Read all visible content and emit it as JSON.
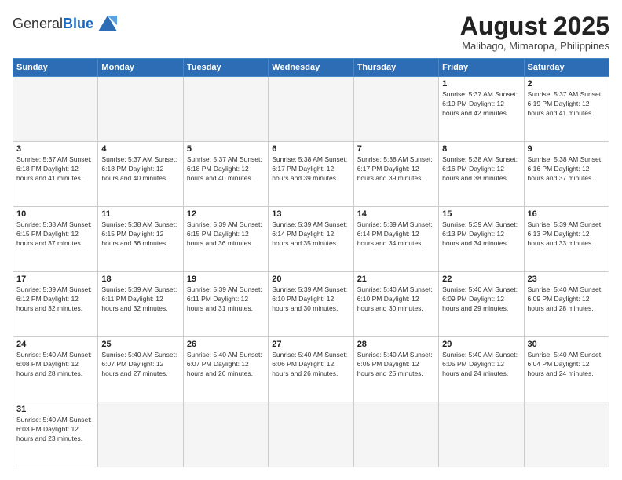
{
  "header": {
    "logo_general": "General",
    "logo_blue": "Blue",
    "month_title": "August 2025",
    "location": "Malibago, Mimaropa, Philippines"
  },
  "weekdays": [
    "Sunday",
    "Monday",
    "Tuesday",
    "Wednesday",
    "Thursday",
    "Friday",
    "Saturday"
  ],
  "weeks": [
    [
      {
        "day": "",
        "info": ""
      },
      {
        "day": "",
        "info": ""
      },
      {
        "day": "",
        "info": ""
      },
      {
        "day": "",
        "info": ""
      },
      {
        "day": "",
        "info": ""
      },
      {
        "day": "1",
        "info": "Sunrise: 5:37 AM\nSunset: 6:19 PM\nDaylight: 12 hours\nand 42 minutes."
      },
      {
        "day": "2",
        "info": "Sunrise: 5:37 AM\nSunset: 6:19 PM\nDaylight: 12 hours\nand 41 minutes."
      }
    ],
    [
      {
        "day": "3",
        "info": "Sunrise: 5:37 AM\nSunset: 6:18 PM\nDaylight: 12 hours\nand 41 minutes."
      },
      {
        "day": "4",
        "info": "Sunrise: 5:37 AM\nSunset: 6:18 PM\nDaylight: 12 hours\nand 40 minutes."
      },
      {
        "day": "5",
        "info": "Sunrise: 5:37 AM\nSunset: 6:18 PM\nDaylight: 12 hours\nand 40 minutes."
      },
      {
        "day": "6",
        "info": "Sunrise: 5:38 AM\nSunset: 6:17 PM\nDaylight: 12 hours\nand 39 minutes."
      },
      {
        "day": "7",
        "info": "Sunrise: 5:38 AM\nSunset: 6:17 PM\nDaylight: 12 hours\nand 39 minutes."
      },
      {
        "day": "8",
        "info": "Sunrise: 5:38 AM\nSunset: 6:16 PM\nDaylight: 12 hours\nand 38 minutes."
      },
      {
        "day": "9",
        "info": "Sunrise: 5:38 AM\nSunset: 6:16 PM\nDaylight: 12 hours\nand 37 minutes."
      }
    ],
    [
      {
        "day": "10",
        "info": "Sunrise: 5:38 AM\nSunset: 6:15 PM\nDaylight: 12 hours\nand 37 minutes."
      },
      {
        "day": "11",
        "info": "Sunrise: 5:38 AM\nSunset: 6:15 PM\nDaylight: 12 hours\nand 36 minutes."
      },
      {
        "day": "12",
        "info": "Sunrise: 5:39 AM\nSunset: 6:15 PM\nDaylight: 12 hours\nand 36 minutes."
      },
      {
        "day": "13",
        "info": "Sunrise: 5:39 AM\nSunset: 6:14 PM\nDaylight: 12 hours\nand 35 minutes."
      },
      {
        "day": "14",
        "info": "Sunrise: 5:39 AM\nSunset: 6:14 PM\nDaylight: 12 hours\nand 34 minutes."
      },
      {
        "day": "15",
        "info": "Sunrise: 5:39 AM\nSunset: 6:13 PM\nDaylight: 12 hours\nand 34 minutes."
      },
      {
        "day": "16",
        "info": "Sunrise: 5:39 AM\nSunset: 6:13 PM\nDaylight: 12 hours\nand 33 minutes."
      }
    ],
    [
      {
        "day": "17",
        "info": "Sunrise: 5:39 AM\nSunset: 6:12 PM\nDaylight: 12 hours\nand 32 minutes."
      },
      {
        "day": "18",
        "info": "Sunrise: 5:39 AM\nSunset: 6:11 PM\nDaylight: 12 hours\nand 32 minutes."
      },
      {
        "day": "19",
        "info": "Sunrise: 5:39 AM\nSunset: 6:11 PM\nDaylight: 12 hours\nand 31 minutes."
      },
      {
        "day": "20",
        "info": "Sunrise: 5:39 AM\nSunset: 6:10 PM\nDaylight: 12 hours\nand 30 minutes."
      },
      {
        "day": "21",
        "info": "Sunrise: 5:40 AM\nSunset: 6:10 PM\nDaylight: 12 hours\nand 30 minutes."
      },
      {
        "day": "22",
        "info": "Sunrise: 5:40 AM\nSunset: 6:09 PM\nDaylight: 12 hours\nand 29 minutes."
      },
      {
        "day": "23",
        "info": "Sunrise: 5:40 AM\nSunset: 6:09 PM\nDaylight: 12 hours\nand 28 minutes."
      }
    ],
    [
      {
        "day": "24",
        "info": "Sunrise: 5:40 AM\nSunset: 6:08 PM\nDaylight: 12 hours\nand 28 minutes."
      },
      {
        "day": "25",
        "info": "Sunrise: 5:40 AM\nSunset: 6:07 PM\nDaylight: 12 hours\nand 27 minutes."
      },
      {
        "day": "26",
        "info": "Sunrise: 5:40 AM\nSunset: 6:07 PM\nDaylight: 12 hours\nand 26 minutes."
      },
      {
        "day": "27",
        "info": "Sunrise: 5:40 AM\nSunset: 6:06 PM\nDaylight: 12 hours\nand 26 minutes."
      },
      {
        "day": "28",
        "info": "Sunrise: 5:40 AM\nSunset: 6:05 PM\nDaylight: 12 hours\nand 25 minutes."
      },
      {
        "day": "29",
        "info": "Sunrise: 5:40 AM\nSunset: 6:05 PM\nDaylight: 12 hours\nand 24 minutes."
      },
      {
        "day": "30",
        "info": "Sunrise: 5:40 AM\nSunset: 6:04 PM\nDaylight: 12 hours\nand 24 minutes."
      }
    ],
    [
      {
        "day": "31",
        "info": "Sunrise: 5:40 AM\nSunset: 6:03 PM\nDaylight: 12 hours\nand 23 minutes."
      },
      {
        "day": "",
        "info": ""
      },
      {
        "day": "",
        "info": ""
      },
      {
        "day": "",
        "info": ""
      },
      {
        "day": "",
        "info": ""
      },
      {
        "day": "",
        "info": ""
      },
      {
        "day": "",
        "info": ""
      }
    ]
  ]
}
